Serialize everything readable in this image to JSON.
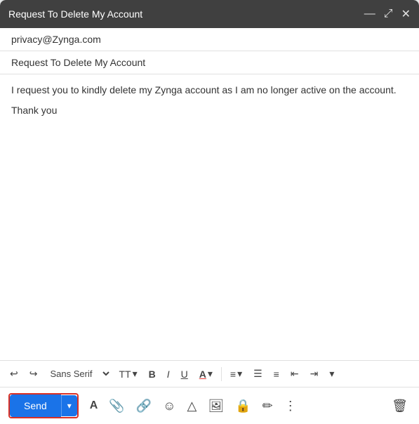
{
  "window": {
    "title": "Request To Delete My Account"
  },
  "controls": {
    "minimize": "—",
    "maximize": "⤢",
    "close": "✕"
  },
  "fields": {
    "to": "privacy@Zynga.com",
    "subject": "Request To Delete My Account"
  },
  "body": {
    "line1": "I request you to kindly delete my Zynga account as I am no longer active on the account.",
    "line2": "Thank you"
  },
  "toolbar": {
    "undo": "↩",
    "redo": "↪",
    "font": "Sans Serif",
    "text_size_label": "TT",
    "bold": "B",
    "italic": "I",
    "underline": "U",
    "font_color": "A",
    "align": "≡",
    "numbered_list": "⁋",
    "bullet_list": "≡",
    "indent_less": "⇤",
    "indent_more": "⇥",
    "more": "⌄"
  },
  "bottom_bar": {
    "send_label": "Send",
    "format_options_label": "A",
    "attach_label": "📎",
    "link_label": "🔗",
    "emoji_label": "☺",
    "drive_label": "△",
    "photo_label": "🖼",
    "lock_label": "🔒",
    "pen_label": "✏",
    "more_label": "⋮",
    "delete_label": "🗑"
  }
}
